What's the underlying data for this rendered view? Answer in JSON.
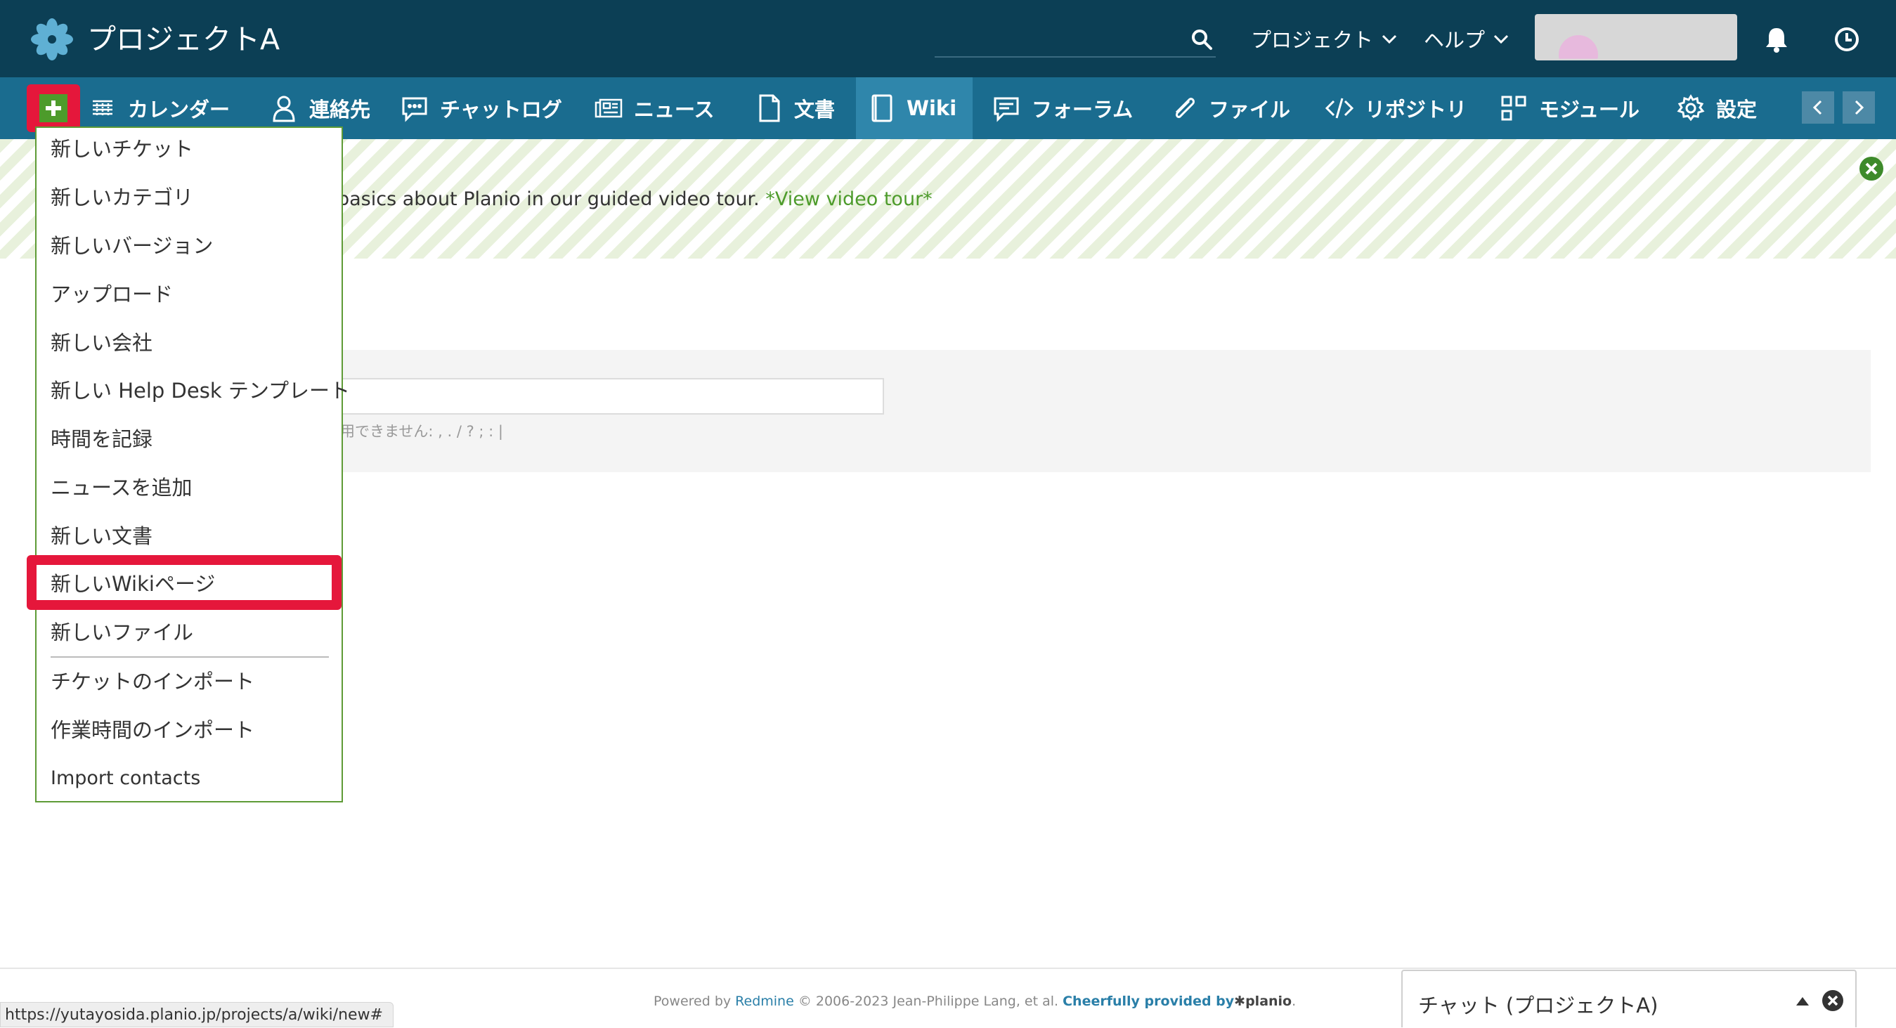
{
  "header": {
    "project_title": "プロジェクトA",
    "search_placeholder": "",
    "menu_project": "プロジェクト",
    "menu_help": "ヘルプ",
    "icons": [
      "logo-asterisk-icon",
      "search-icon",
      "chevron-down-icon",
      "bell-icon",
      "clock-icon"
    ]
  },
  "nav": {
    "tabs": [
      {
        "label": "カレンダー",
        "icon": "calendar-icon"
      },
      {
        "label": "連絡先",
        "icon": "contact-icon"
      },
      {
        "label": "チャットログ",
        "icon": "chat-icon"
      },
      {
        "label": "ニュース",
        "icon": "news-icon"
      },
      {
        "label": "文書",
        "icon": "document-icon"
      },
      {
        "label": "Wiki",
        "icon": "wiki-icon",
        "selected": true
      },
      {
        "label": "フォーラム",
        "icon": "forum-icon"
      },
      {
        "label": "ファイル",
        "icon": "paperclip-icon"
      },
      {
        "label": "リポジトリ",
        "icon": "code-icon"
      },
      {
        "label": "モジュール",
        "icon": "modules-icon"
      },
      {
        "label": "設定",
        "icon": "gear-icon"
      }
    ]
  },
  "banner": {
    "text": "basics about Planio in our guided video tour.",
    "link": "*View video tour*"
  },
  "form": {
    "hint": "用できません: , . / ? ; : |"
  },
  "dropdown": {
    "items": [
      "新しいチケット",
      "新しいカテゴリ",
      "新しいバージョン",
      "アップロード",
      "新しい会社",
      "新しい Help Desk テンプレート",
      "時間を記録",
      "ニュースを追加",
      "新しい文書",
      "新しいWikiページ",
      "新しいファイル"
    ],
    "import_items": [
      "チケットのインポート",
      "作業時間のインポート",
      "Import contacts"
    ],
    "highlighted_item": "新しいWikiページ"
  },
  "footer": {
    "powered_by": "Powered by",
    "redmine": "Redmine",
    "copyright": "© 2006-2023 Jean-Philippe Lang, et al.",
    "cheerfully": "Cheerfully provided by",
    "brand": "✱planio",
    "period": "."
  },
  "status_url": "https://yutayosida.planio.jp/projects/a/wiki/new#",
  "chat": {
    "title": "チャット (プロジェクトA)"
  },
  "colors": {
    "header_bg": "#0c3f55",
    "nav_bg": "#1a6c8f",
    "nav_selected": "#2f86ab",
    "accent_green": "#4d9b2b",
    "highlight_red": "#e5173b"
  }
}
